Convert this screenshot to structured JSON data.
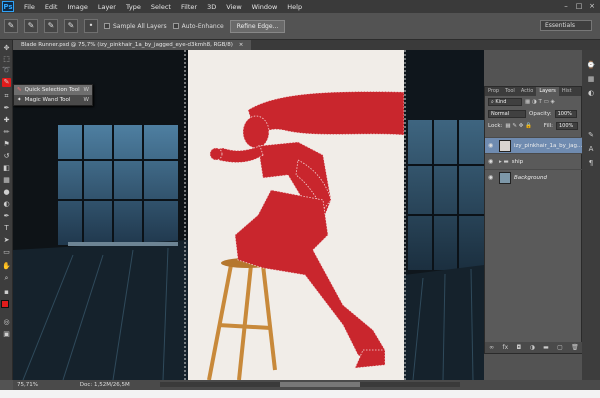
{
  "menubar": {
    "logo": "Ps",
    "items": [
      "File",
      "Edit",
      "Image",
      "Layer",
      "Type",
      "Select",
      "Filter",
      "3D",
      "View",
      "Window",
      "Help"
    ],
    "window_controls": [
      "–",
      "□",
      "×"
    ]
  },
  "options": {
    "sample_all_layers": "Sample All Layers",
    "auto_enhance": "Auto-Enhance",
    "refine_edge": "Refine Edge...",
    "workspace": "Essentials"
  },
  "document": {
    "tab_title": "Blade Runner.psd @ 75,7% (izy_pinkhair_1a_by_jagged_eye-d3kmh8, RGB/8)",
    "close": "×"
  },
  "flyout": {
    "items": [
      {
        "label": "Quick Selection Tool",
        "key": "W"
      },
      {
        "label": "Magic Wand Tool",
        "key": "W"
      }
    ]
  },
  "layers_panel": {
    "tabs": [
      "Prop",
      "Tool",
      "Actio",
      "Layers",
      "Hist"
    ],
    "kind_label": "Kind",
    "blend_mode": "Normal",
    "opacity_label": "Opacity:",
    "opacity_value": "100%",
    "lock_label": "Lock:",
    "fill_label": "Fill:",
    "fill_value": "100%",
    "layers": [
      {
        "name": "izy_pinkhair_1a_by_jag...",
        "active": true
      },
      {
        "name": "ship",
        "active": false
      },
      {
        "name": "Background",
        "active": false
      }
    ],
    "footer_icons": [
      "link",
      "fx",
      "mask",
      "adjust",
      "folder",
      "new",
      "trash"
    ]
  },
  "status": {
    "zoom": "75,71%",
    "doc": "Doc: 1,52M/26,5M"
  },
  "colors": {
    "foreground": "#e01b1b",
    "selection_overlay": "#d0252d"
  }
}
